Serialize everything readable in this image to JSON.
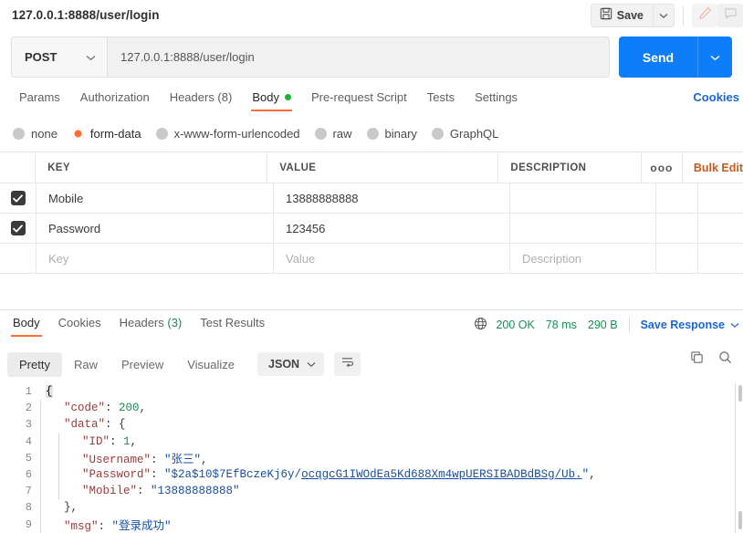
{
  "topbar": {
    "request_title": "127.0.0.1:8888/user/login",
    "save_label": "Save",
    "save_icon": "floppy-disk-icon",
    "caret_icon": "chevron-down-icon",
    "edit_icon": "pencil-icon",
    "comment_icon": "comment-icon"
  },
  "urlrow": {
    "method": "POST",
    "method_caret": "chevron-down-icon",
    "url": "127.0.0.1:8888/user/login",
    "send_label": "Send",
    "send_caret": "chevron-down-icon"
  },
  "request_tabs": {
    "items": [
      {
        "label": "Params",
        "active": false
      },
      {
        "label": "Authorization",
        "active": false
      },
      {
        "label": "Headers (8)",
        "active": false
      },
      {
        "label": "Body",
        "active": true
      },
      {
        "label": "Pre-request Script",
        "active": false
      },
      {
        "label": "Tests",
        "active": false
      },
      {
        "label": "Settings",
        "active": false
      }
    ],
    "cookies_link": "Cookies"
  },
  "body_types": [
    {
      "label": "none",
      "selected": false
    },
    {
      "label": "form-data",
      "selected": true
    },
    {
      "label": "x-www-form-urlencoded",
      "selected": false
    },
    {
      "label": "raw",
      "selected": false
    },
    {
      "label": "binary",
      "selected": false
    },
    {
      "label": "GraphQL",
      "selected": false
    }
  ],
  "kv_table": {
    "headers": {
      "key": "KEY",
      "value": "VALUE",
      "description": "DESCRIPTION"
    },
    "menu_label": "ooo",
    "bulk_edit_label": "Bulk Edit",
    "rows": [
      {
        "checked": true,
        "key": "Mobile",
        "value": "13888888888",
        "description": ""
      },
      {
        "checked": true,
        "key": "Password",
        "value": "123456",
        "description": ""
      }
    ],
    "placeholder_row": {
      "key": "Key",
      "value": "Value",
      "description": "Description"
    }
  },
  "response_tabs": {
    "items": [
      {
        "label": "Body",
        "active": true
      },
      {
        "label": "Cookies",
        "active": false
      },
      {
        "label": "Headers",
        "count": "(3)",
        "active": false
      },
      {
        "label": "Test Results",
        "active": false
      }
    ]
  },
  "response_meta": {
    "globe_icon": "globe-icon",
    "status": "200 OK",
    "time": "78 ms",
    "size": "290 B",
    "save_response_label": "Save Response",
    "save_response_caret": "chevron-down-icon"
  },
  "viewer_toolbar": {
    "modes": [
      {
        "label": "Pretty",
        "selected": true
      },
      {
        "label": "Raw",
        "selected": false
      },
      {
        "label": "Preview",
        "selected": false
      },
      {
        "label": "Visualize",
        "selected": false
      }
    ],
    "format": "JSON",
    "format_caret": "chevron-down-icon",
    "wrap_icon": "word-wrap-icon",
    "copy_icon": "copy-icon",
    "search_icon": "search-icon"
  },
  "response_body": {
    "language": "json",
    "lines": [
      {
        "num": "1",
        "indent": 0,
        "tokens": [
          {
            "t": "{",
            "c": "brace-hl"
          }
        ]
      },
      {
        "num": "2",
        "indent": 1,
        "tokens": [
          {
            "t": "\"code\"",
            "c": "k"
          },
          {
            "t": ": ",
            "c": "p"
          },
          {
            "t": "200",
            "c": "n"
          },
          {
            "t": ",",
            "c": "p"
          }
        ]
      },
      {
        "num": "3",
        "indent": 1,
        "tokens": [
          {
            "t": "\"data\"",
            "c": "k"
          },
          {
            "t": ": {",
            "c": "p"
          }
        ]
      },
      {
        "num": "4",
        "indent": 2,
        "tokens": [
          {
            "t": "\"ID\"",
            "c": "k"
          },
          {
            "t": ": ",
            "c": "p"
          },
          {
            "t": "1",
            "c": "n"
          },
          {
            "t": ",",
            "c": "p"
          }
        ]
      },
      {
        "num": "5",
        "indent": 2,
        "tokens": [
          {
            "t": "\"Username\"",
            "c": "k"
          },
          {
            "t": ": ",
            "c": "p"
          },
          {
            "t": "\"张三\"",
            "c": "s"
          },
          {
            "t": ",",
            "c": "p"
          }
        ]
      },
      {
        "num": "6",
        "indent": 2,
        "tokens": [
          {
            "t": "\"Password\"",
            "c": "k"
          },
          {
            "t": ": ",
            "c": "p"
          },
          {
            "t": "\"$2a$10$7EfBczeKj6y/",
            "c": "s"
          },
          {
            "t": "ocqgcG1IWOdEa5Kd688Xm4wpUERSIBADBdBSg/Ub.",
            "c": "lnk"
          },
          {
            "t": "\"",
            "c": "s"
          },
          {
            "t": ",",
            "c": "p"
          }
        ]
      },
      {
        "num": "7",
        "indent": 2,
        "tokens": [
          {
            "t": "\"Mobile\"",
            "c": "k"
          },
          {
            "t": ": ",
            "c": "p"
          },
          {
            "t": "\"13888888888\"",
            "c": "s"
          }
        ]
      },
      {
        "num": "8",
        "indent": 1,
        "tokens": [
          {
            "t": "},",
            "c": "p"
          }
        ]
      },
      {
        "num": "9",
        "indent": 1,
        "tokens": [
          {
            "t": "\"msg\"",
            "c": "k"
          },
          {
            "t": ": ",
            "c": "p"
          },
          {
            "t": "\"登录成功\"",
            "c": "s"
          }
        ]
      }
    ]
  }
}
